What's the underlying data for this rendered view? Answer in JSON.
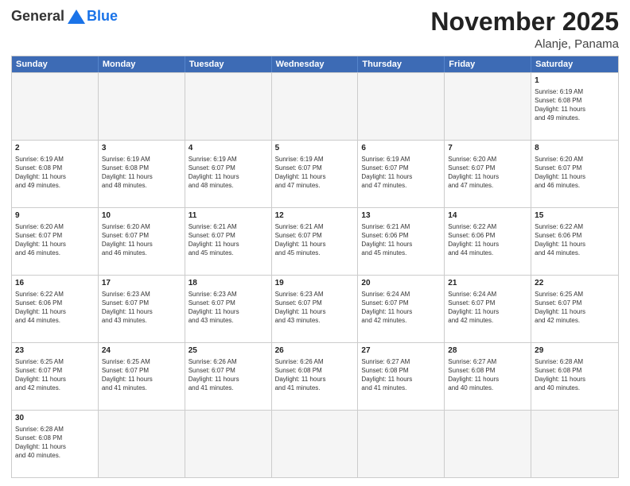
{
  "header": {
    "logo_general": "General",
    "logo_blue": "Blue",
    "month_title": "November 2025",
    "location": "Alanje, Panama"
  },
  "calendar": {
    "days_of_week": [
      "Sunday",
      "Monday",
      "Tuesday",
      "Wednesday",
      "Thursday",
      "Friday",
      "Saturday"
    ],
    "rows": [
      [
        {
          "day": "",
          "empty": true,
          "lines": []
        },
        {
          "day": "",
          "empty": true,
          "lines": []
        },
        {
          "day": "",
          "empty": true,
          "lines": []
        },
        {
          "day": "",
          "empty": true,
          "lines": []
        },
        {
          "day": "",
          "empty": true,
          "lines": []
        },
        {
          "day": "",
          "empty": true,
          "lines": []
        },
        {
          "day": "1",
          "empty": false,
          "lines": [
            "Sunrise: 6:19 AM",
            "Sunset: 6:08 PM",
            "Daylight: 11 hours",
            "and 49 minutes."
          ]
        }
      ],
      [
        {
          "day": "2",
          "empty": false,
          "lines": [
            "Sunrise: 6:19 AM",
            "Sunset: 6:08 PM",
            "Daylight: 11 hours",
            "and 49 minutes."
          ]
        },
        {
          "day": "3",
          "empty": false,
          "lines": [
            "Sunrise: 6:19 AM",
            "Sunset: 6:08 PM",
            "Daylight: 11 hours",
            "and 48 minutes."
          ]
        },
        {
          "day": "4",
          "empty": false,
          "lines": [
            "Sunrise: 6:19 AM",
            "Sunset: 6:07 PM",
            "Daylight: 11 hours",
            "and 48 minutes."
          ]
        },
        {
          "day": "5",
          "empty": false,
          "lines": [
            "Sunrise: 6:19 AM",
            "Sunset: 6:07 PM",
            "Daylight: 11 hours",
            "and 47 minutes."
          ]
        },
        {
          "day": "6",
          "empty": false,
          "lines": [
            "Sunrise: 6:19 AM",
            "Sunset: 6:07 PM",
            "Daylight: 11 hours",
            "and 47 minutes."
          ]
        },
        {
          "day": "7",
          "empty": false,
          "lines": [
            "Sunrise: 6:20 AM",
            "Sunset: 6:07 PM",
            "Daylight: 11 hours",
            "and 47 minutes."
          ]
        },
        {
          "day": "8",
          "empty": false,
          "lines": [
            "Sunrise: 6:20 AM",
            "Sunset: 6:07 PM",
            "Daylight: 11 hours",
            "and 46 minutes."
          ]
        }
      ],
      [
        {
          "day": "9",
          "empty": false,
          "lines": [
            "Sunrise: 6:20 AM",
            "Sunset: 6:07 PM",
            "Daylight: 11 hours",
            "and 46 minutes."
          ]
        },
        {
          "day": "10",
          "empty": false,
          "lines": [
            "Sunrise: 6:20 AM",
            "Sunset: 6:07 PM",
            "Daylight: 11 hours",
            "and 46 minutes."
          ]
        },
        {
          "day": "11",
          "empty": false,
          "lines": [
            "Sunrise: 6:21 AM",
            "Sunset: 6:07 PM",
            "Daylight: 11 hours",
            "and 45 minutes."
          ]
        },
        {
          "day": "12",
          "empty": false,
          "lines": [
            "Sunrise: 6:21 AM",
            "Sunset: 6:07 PM",
            "Daylight: 11 hours",
            "and 45 minutes."
          ]
        },
        {
          "day": "13",
          "empty": false,
          "lines": [
            "Sunrise: 6:21 AM",
            "Sunset: 6:06 PM",
            "Daylight: 11 hours",
            "and 45 minutes."
          ]
        },
        {
          "day": "14",
          "empty": false,
          "lines": [
            "Sunrise: 6:22 AM",
            "Sunset: 6:06 PM",
            "Daylight: 11 hours",
            "and 44 minutes."
          ]
        },
        {
          "day": "15",
          "empty": false,
          "lines": [
            "Sunrise: 6:22 AM",
            "Sunset: 6:06 PM",
            "Daylight: 11 hours",
            "and 44 minutes."
          ]
        }
      ],
      [
        {
          "day": "16",
          "empty": false,
          "lines": [
            "Sunrise: 6:22 AM",
            "Sunset: 6:06 PM",
            "Daylight: 11 hours",
            "and 44 minutes."
          ]
        },
        {
          "day": "17",
          "empty": false,
          "lines": [
            "Sunrise: 6:23 AM",
            "Sunset: 6:07 PM",
            "Daylight: 11 hours",
            "and 43 minutes."
          ]
        },
        {
          "day": "18",
          "empty": false,
          "lines": [
            "Sunrise: 6:23 AM",
            "Sunset: 6:07 PM",
            "Daylight: 11 hours",
            "and 43 minutes."
          ]
        },
        {
          "day": "19",
          "empty": false,
          "lines": [
            "Sunrise: 6:23 AM",
            "Sunset: 6:07 PM",
            "Daylight: 11 hours",
            "and 43 minutes."
          ]
        },
        {
          "day": "20",
          "empty": false,
          "lines": [
            "Sunrise: 6:24 AM",
            "Sunset: 6:07 PM",
            "Daylight: 11 hours",
            "and 42 minutes."
          ]
        },
        {
          "day": "21",
          "empty": false,
          "lines": [
            "Sunrise: 6:24 AM",
            "Sunset: 6:07 PM",
            "Daylight: 11 hours",
            "and 42 minutes."
          ]
        },
        {
          "day": "22",
          "empty": false,
          "lines": [
            "Sunrise: 6:25 AM",
            "Sunset: 6:07 PM",
            "Daylight: 11 hours",
            "and 42 minutes."
          ]
        }
      ],
      [
        {
          "day": "23",
          "empty": false,
          "lines": [
            "Sunrise: 6:25 AM",
            "Sunset: 6:07 PM",
            "Daylight: 11 hours",
            "and 42 minutes."
          ]
        },
        {
          "day": "24",
          "empty": false,
          "lines": [
            "Sunrise: 6:25 AM",
            "Sunset: 6:07 PM",
            "Daylight: 11 hours",
            "and 41 minutes."
          ]
        },
        {
          "day": "25",
          "empty": false,
          "lines": [
            "Sunrise: 6:26 AM",
            "Sunset: 6:07 PM",
            "Daylight: 11 hours",
            "and 41 minutes."
          ]
        },
        {
          "day": "26",
          "empty": false,
          "lines": [
            "Sunrise: 6:26 AM",
            "Sunset: 6:08 PM",
            "Daylight: 11 hours",
            "and 41 minutes."
          ]
        },
        {
          "day": "27",
          "empty": false,
          "lines": [
            "Sunrise: 6:27 AM",
            "Sunset: 6:08 PM",
            "Daylight: 11 hours",
            "and 41 minutes."
          ]
        },
        {
          "day": "28",
          "empty": false,
          "lines": [
            "Sunrise: 6:27 AM",
            "Sunset: 6:08 PM",
            "Daylight: 11 hours",
            "and 40 minutes."
          ]
        },
        {
          "day": "29",
          "empty": false,
          "lines": [
            "Sunrise: 6:28 AM",
            "Sunset: 6:08 PM",
            "Daylight: 11 hours",
            "and 40 minutes."
          ]
        }
      ],
      [
        {
          "day": "30",
          "empty": false,
          "lines": [
            "Sunrise: 6:28 AM",
            "Sunset: 6:08 PM",
            "Daylight: 11 hours",
            "and 40 minutes."
          ]
        },
        {
          "day": "",
          "empty": true,
          "lines": []
        },
        {
          "day": "",
          "empty": true,
          "lines": []
        },
        {
          "day": "",
          "empty": true,
          "lines": []
        },
        {
          "day": "",
          "empty": true,
          "lines": []
        },
        {
          "day": "",
          "empty": true,
          "lines": []
        },
        {
          "day": "",
          "empty": true,
          "lines": []
        }
      ]
    ]
  }
}
